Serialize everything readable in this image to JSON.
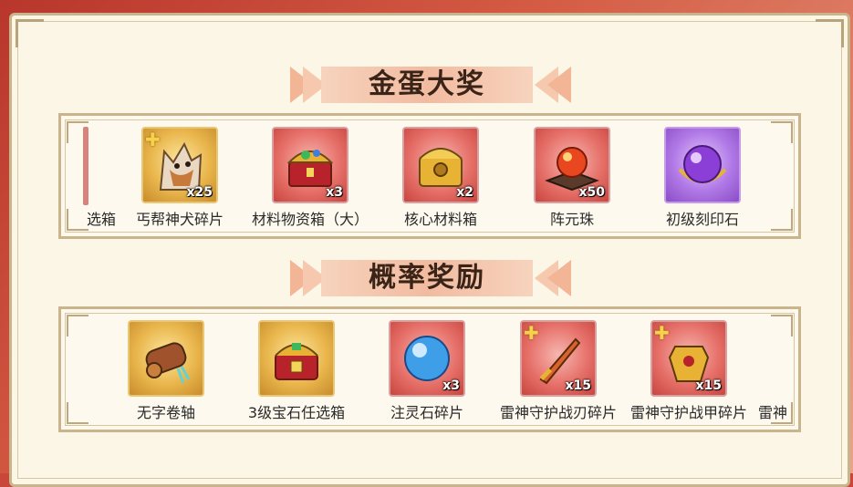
{
  "sections": [
    {
      "title": "金蛋大奖",
      "edge_left_label": "选箱",
      "items": [
        {
          "label": "丐帮神犬碎片",
          "qty": "x25",
          "icon": "wolf-icon",
          "fragment": true
        },
        {
          "label": "材料物资箱（大）",
          "qty": "x3",
          "icon": "treasure-chest-icon",
          "fragment": false
        },
        {
          "label": "核心材料箱",
          "qty": "x2",
          "icon": "golden-chest-icon",
          "fragment": false
        },
        {
          "label": "阵元珠",
          "qty": "x50",
          "icon": "red-orb-icon",
          "fragment": false
        },
        {
          "label": "初级刻印石",
          "qty": "",
          "icon": "purple-orb-icon",
          "fragment": false
        }
      ]
    },
    {
      "title": "概率奖励",
      "edge_left_label": "",
      "edge_right_label": "雷神",
      "items": [
        {
          "label": "无字卷轴",
          "qty": "",
          "icon": "scroll-icon",
          "fragment": false
        },
        {
          "label": "3级宝石任选箱",
          "qty": "",
          "icon": "gem-chest-icon",
          "fragment": false
        },
        {
          "label": "注灵石碎片",
          "qty": "x3",
          "icon": "blue-orb-icon",
          "fragment": false
        },
        {
          "label": "雷神守护战刃碎片",
          "qty": "x15",
          "icon": "sword-icon",
          "fragment": true
        },
        {
          "label": "雷神守护战甲碎片",
          "qty": "x15",
          "icon": "armor-icon",
          "fragment": true
        }
      ]
    }
  ],
  "colors": {
    "panel": "#fbf6e6",
    "border": "#c9b48c",
    "title_bar": "#f2bba0"
  }
}
